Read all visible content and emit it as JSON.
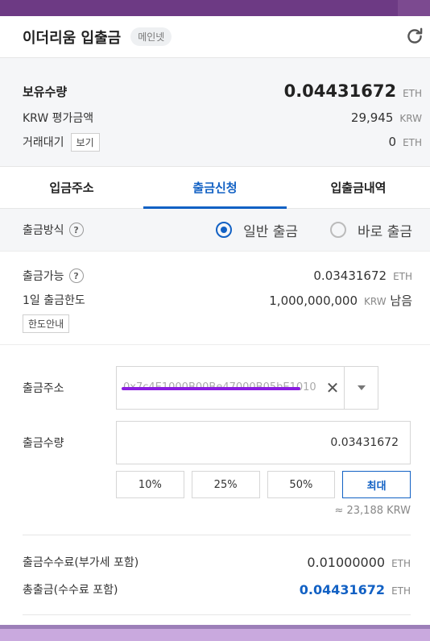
{
  "header": {
    "title": "이더리움 입출금",
    "network_badge": "메인넷",
    "refresh_icon": "refresh-icon"
  },
  "balance": {
    "holdings_label": "보유수량",
    "holdings_value": "0.04431672",
    "holdings_unit": "ETH",
    "krw_label": "KRW 평가금액",
    "krw_value": "29,945",
    "krw_unit": "KRW",
    "pending_label": "거래대기",
    "pending_view_button": "보기",
    "pending_value": "0",
    "pending_unit": "ETH"
  },
  "tabs": [
    {
      "label": "입금주소",
      "active": false
    },
    {
      "label": "출금신청",
      "active": true
    },
    {
      "label": "입출금내역",
      "active": false
    }
  ],
  "method": {
    "label": "출금방식",
    "help": "?",
    "options": [
      {
        "label": "일반 출금",
        "checked": true
      },
      {
        "label": "바로 출금",
        "checked": false
      }
    ]
  },
  "limits": {
    "available_label": "출금가능",
    "help": "?",
    "available_value": "0.03431672",
    "available_unit": "ETH",
    "daily_label": "1일 출금한도",
    "daily_value": "1,000,000,000",
    "daily_unit": "KRW",
    "daily_suffix": "남음",
    "limit_info_button": "한도안내"
  },
  "form": {
    "address_label": "출금주소",
    "address_value": "0x7c4E1000B00Be47000B05bE1010",
    "address_clear": "✕",
    "quantity_label": "출금수량",
    "quantity_value": "0.03431672",
    "percent_buttons": [
      "10%",
      "25%",
      "50%"
    ],
    "max_button": "최대",
    "approx_krw": "≈ 23,188 KRW"
  },
  "fees": {
    "fee_label": "출금수수료(부가세 포함)",
    "fee_value": "0.01000000",
    "fee_unit": "ETH",
    "total_label": "총출금(수수료 포함)",
    "total_value": "0.04431672",
    "total_unit": "ETH"
  },
  "colors": {
    "accent": "#1261c4",
    "frame_top": "#6d3a84",
    "frame_bottom": "#c9a9de",
    "redaction": "#8a1ee0"
  }
}
